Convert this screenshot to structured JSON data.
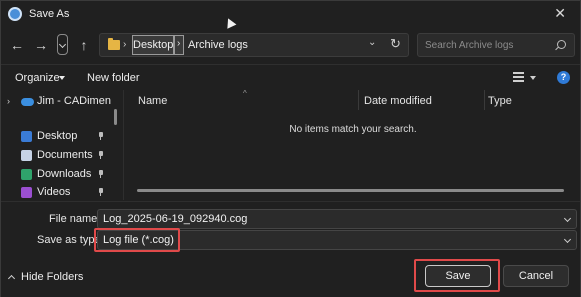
{
  "window": {
    "title": "Save As"
  },
  "toolbar": {
    "back_icon": "arrow-left",
    "forward_icon": "arrow-right",
    "up_icon": "arrow-up",
    "refresh_icon": "refresh"
  },
  "address": {
    "crumbs": [
      "Desktop",
      "Archive logs"
    ]
  },
  "search": {
    "placeholder": "Search Archive logs"
  },
  "command_bar": {
    "organize_label": "Organize",
    "new_folder_label": "New folder",
    "help_label": "?"
  },
  "nav_pane": {
    "items": [
      {
        "label": "Jim - CADimensions",
        "icon_color": "#3b8fe0",
        "pinned": false
      },
      {
        "label": "Desktop",
        "icon_color": "#3a7bd5",
        "pinned": true
      },
      {
        "label": "Documents",
        "icon_color": "#c7d3e6",
        "pinned": true
      },
      {
        "label": "Downloads",
        "icon_color": "#2fa36b",
        "pinned": true
      },
      {
        "label": "Videos",
        "icon_color": "#9b4fd1",
        "pinned": true
      }
    ]
  },
  "file_list": {
    "columns": [
      "Name",
      "Date modified",
      "Type"
    ],
    "empty_message": "No items match your search."
  },
  "footer": {
    "file_name_label": "File name:",
    "file_name_value": "Log_2025-06-19_092940.cog",
    "save_as_type_label": "Save as type:",
    "save_as_type_value": "Log file (*.cog)",
    "hide_folders_label": "Hide Folders",
    "save_label": "Save",
    "cancel_label": "Cancel",
    "highlight_color": "#e04a4a"
  }
}
